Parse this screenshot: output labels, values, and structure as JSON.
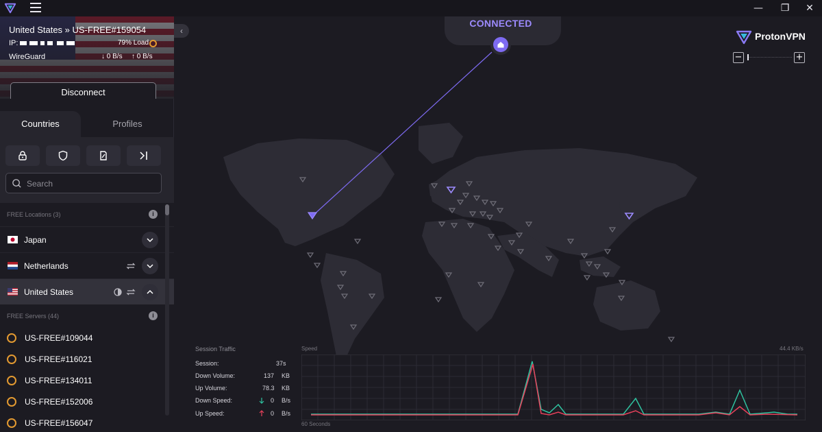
{
  "window": {
    "minimize": "—",
    "maximize": "❐",
    "close": "✕"
  },
  "connection": {
    "title": "United States » US-FREE#159054",
    "ip_label": "IP:",
    "load": "79% Load",
    "protocol": "WireGuard",
    "down_speed": "↓ 0 B/s",
    "up_speed": "↑ 0 B/s",
    "disconnect": "Disconnect"
  },
  "tabs": {
    "countries": "Countries",
    "profiles": "Profiles"
  },
  "search": {
    "placeholder": "Search"
  },
  "free_locations": {
    "header": "FREE Locations (3)",
    "countries": [
      {
        "name": "Japan"
      },
      {
        "name": "Netherlands"
      },
      {
        "name": "United States"
      }
    ]
  },
  "free_servers": {
    "header": "FREE Servers (44)",
    "servers": [
      "US-FREE#109044",
      "US-FREE#116021",
      "US-FREE#134011",
      "US-FREE#152006",
      "US-FREE#156047"
    ]
  },
  "map": {
    "status": "CONNECTED",
    "brand": "ProtonVPN",
    "zoom_out": "−",
    "zoom_in": "+"
  },
  "traffic": {
    "title": "Session Traffic",
    "stats": [
      {
        "label": "Session:",
        "value": "37s",
        "unit": ""
      },
      {
        "label": "Down Volume:",
        "value": "137",
        "unit": "KB"
      },
      {
        "label": "Up Volume:",
        "value": "78.3",
        "unit": "KB"
      },
      {
        "label": "Down Speed:",
        "value": "0",
        "unit": "B/s"
      },
      {
        "label": "Up Speed:",
        "value": "0",
        "unit": "B/s"
      }
    ],
    "speed_label": "Speed",
    "speed_max": "44.4 KB/s",
    "x_label": "60 Seconds"
  },
  "colors": {
    "accent": "#7e6bf2",
    "status": "#9d8bff",
    "load": "#e39a31",
    "download": "#2fc3a0",
    "upload": "#e8415b"
  }
}
